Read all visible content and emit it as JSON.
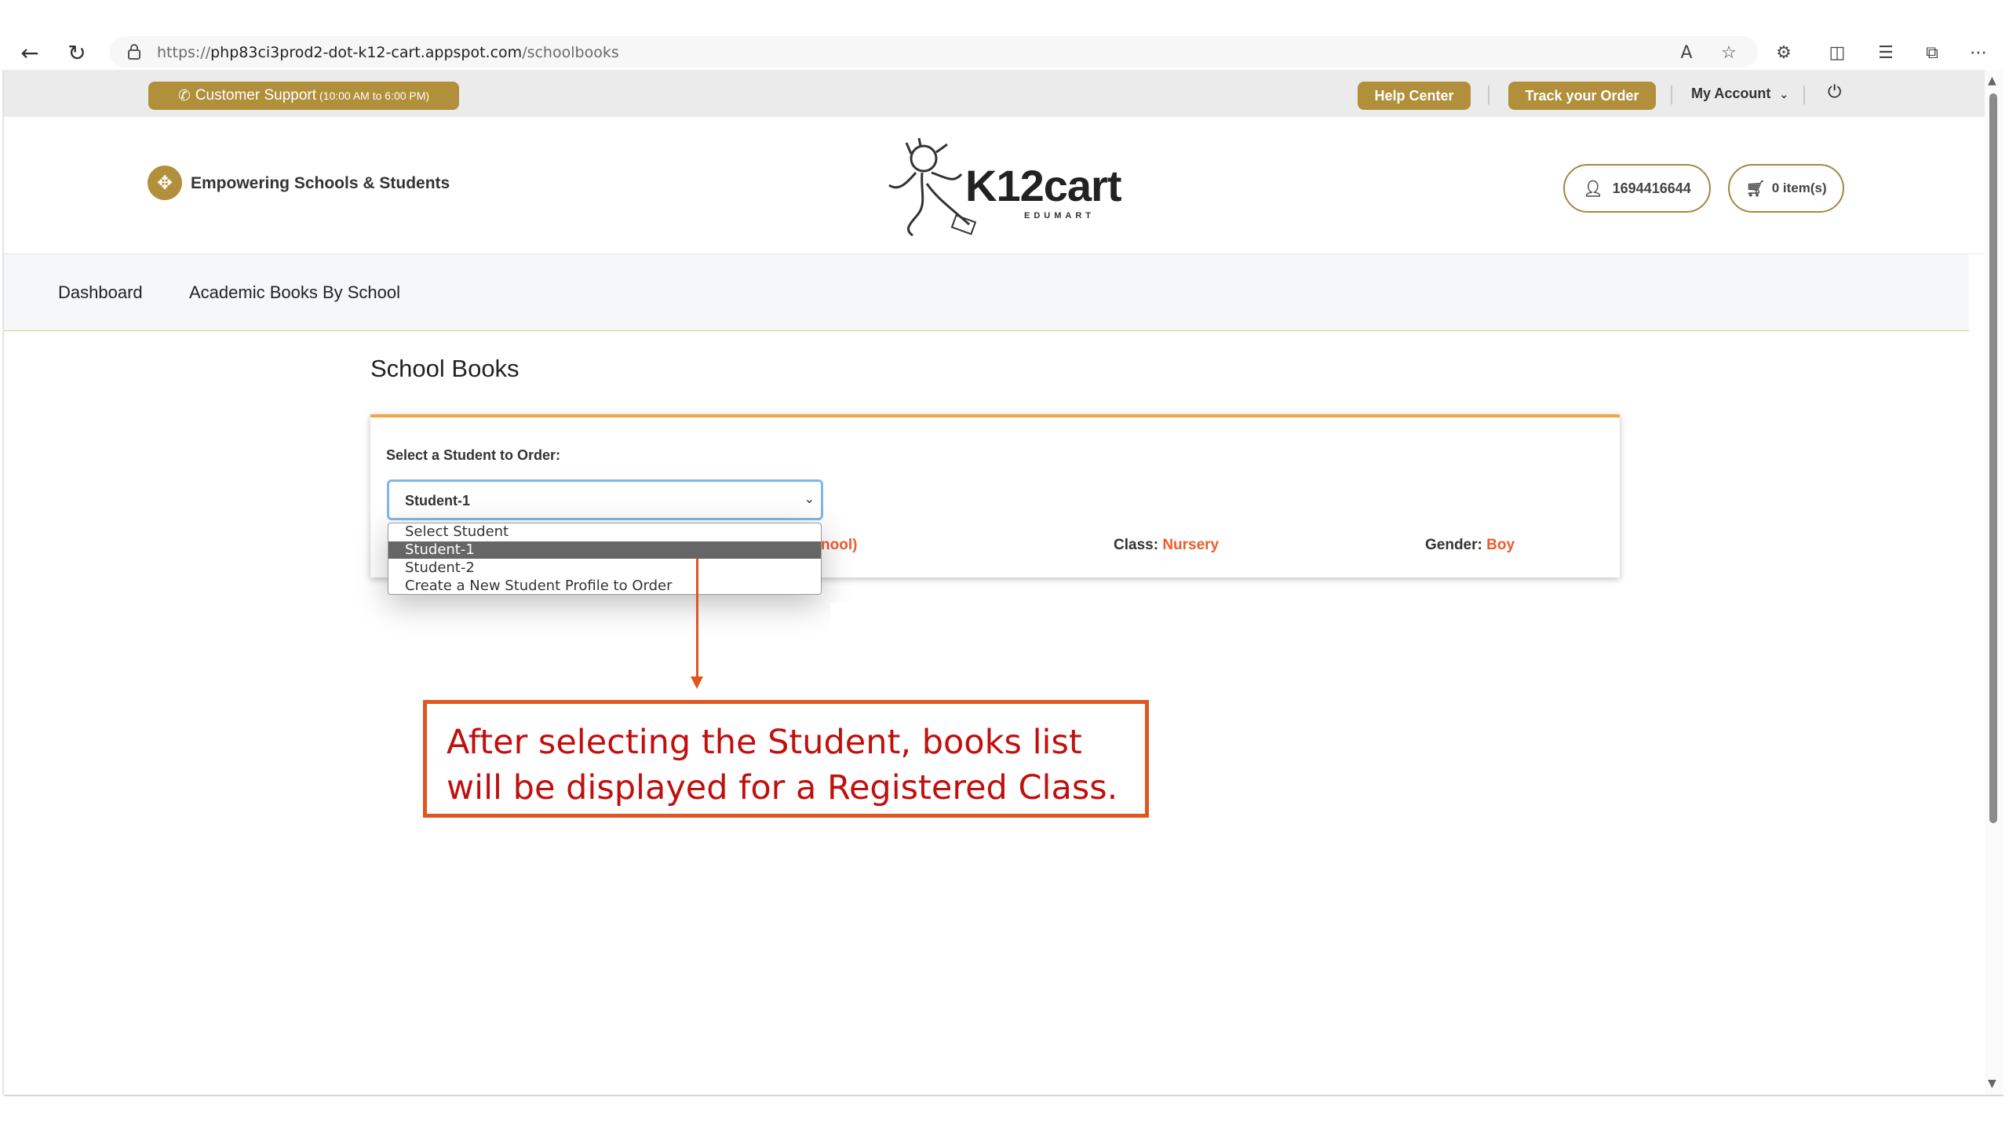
{
  "browser": {
    "url_proto": "https://",
    "url_host": "php83ci3prod2-dot-k12-cart.appspot.com",
    "url_path": "/schoolbooks"
  },
  "topbar": {
    "support_label": "Customer Support",
    "support_hours": "(10:00 AM to 6:00 PM)",
    "help_label": "Help Center",
    "track_label": "Track your Order",
    "account_label": "My Account"
  },
  "header": {
    "tagline": "Empowering Schools & Students",
    "logo_text": "K12cart",
    "logo_sub": "EDUMART",
    "phone": "1694416644",
    "cart": "0 item(s)"
  },
  "nav": {
    "items": [
      {
        "label": "Dashboard"
      },
      {
        "label": "Academic Books By School"
      }
    ]
  },
  "page": {
    "title": "School Books",
    "select_label": "Select a Student to Order:",
    "selected_value": "Student-1",
    "school_fragment": "nool)",
    "class_label": "Class:",
    "class_value": "Nursery",
    "gender_label": "Gender:",
    "gender_value": "Boy"
  },
  "dropdown": {
    "options": [
      {
        "label": "Select Student"
      },
      {
        "label": "Student-1"
      },
      {
        "label": "Student-2"
      },
      {
        "label": "Create a New Student Profile to Order"
      }
    ]
  },
  "annotation": {
    "text": "After selecting the Student, books list will be displayed for a Registered Class."
  },
  "colors": {
    "gold": "#b18f3b",
    "accent_orange": "#ee5b2c",
    "card_border": "#f0a444",
    "callout_red": "#e0561f"
  }
}
